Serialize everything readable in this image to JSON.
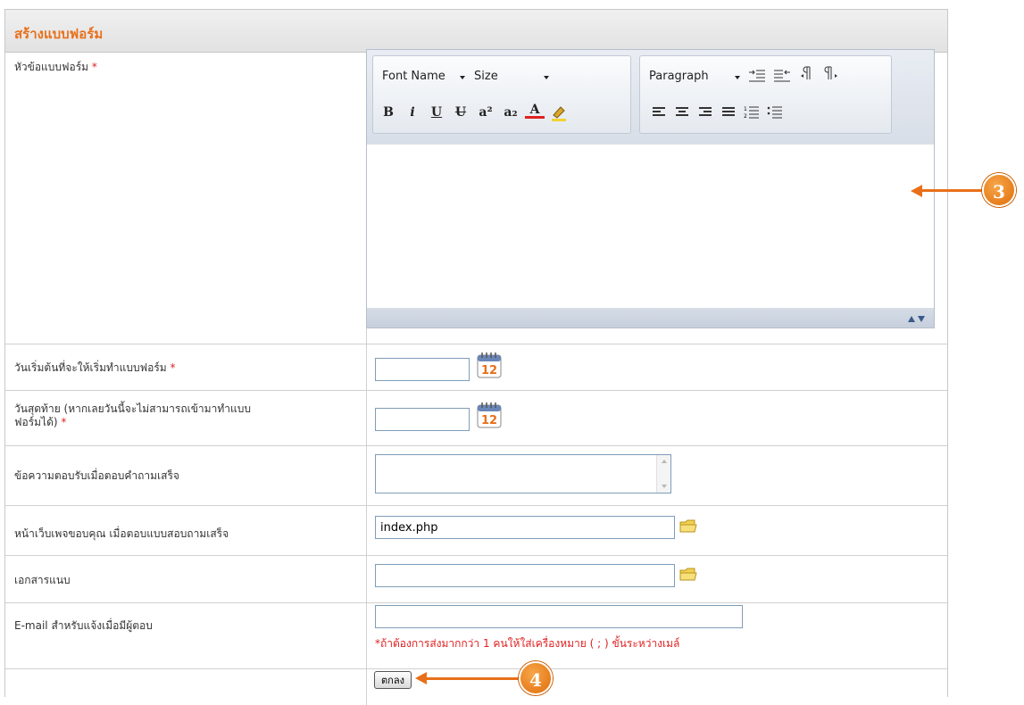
{
  "form": {
    "title": "สร้างแบบฟอร์ม",
    "fields": {
      "subject_label": "หัวข้อแบบฟอร์ม",
      "start_label": "วันเริ่มต้นที่จะให้เริ่มทำแบบฟอร์ม",
      "end_label_line1": "วันสุดท้าย (หากเลยวันนี้จะไม่สามารถเข้ามาทำแบบ",
      "end_label_line2": "ฟอร์มได้)",
      "reply_label": "ข้อความตอบรับเมื่อตอบคำถามเสร็จ",
      "thanks_label": "หน้าเว็บเพจขอบคุณ เมื่อตอบแบบสอบถามเสร็จ",
      "thanks_value": "index.php",
      "attach_label": "เอกสารแนบ",
      "email_label": "E-mail สำหรับแจ้งเมื่อมีผู้ตอบ",
      "email_note": "*ถ้าต้องการส่งมากกว่า 1 คนให้ใส่เครื่องหมาย ( ; ) ขั้นระหว่างเมล์",
      "required_mark": "*",
      "calendar_day": "12"
    },
    "submit_label": "ตกลง"
  },
  "editor": {
    "font_name": "Font Name",
    "size": "Size",
    "paragraph": "Paragraph",
    "buttons": {
      "bold": "B",
      "italic": "i",
      "underline": "U",
      "strike": "U",
      "superscript": "a²",
      "subscript": "a₂",
      "font_color": "A"
    }
  },
  "callouts": {
    "c3": "3",
    "c4": "4"
  },
  "colors": {
    "accent": "#e8701a",
    "required": "#e02020",
    "border": "#c8c8c8"
  }
}
